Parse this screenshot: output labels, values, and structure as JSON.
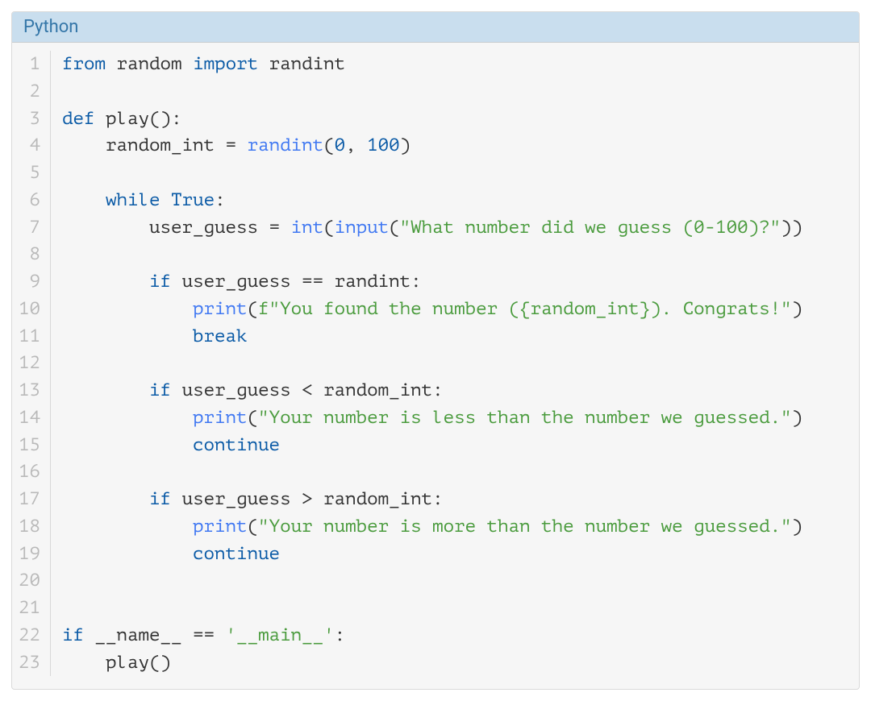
{
  "header": {
    "title": "Python"
  },
  "lineCount": 23,
  "code": {
    "lines": [
      [
        {
          "t": "from",
          "c": "kw"
        },
        {
          "t": " "
        },
        {
          "t": "random",
          "c": "id"
        },
        {
          "t": " "
        },
        {
          "t": "import",
          "c": "kw"
        },
        {
          "t": " "
        },
        {
          "t": "randint",
          "c": "id"
        }
      ],
      [],
      [
        {
          "t": "def",
          "c": "kw"
        },
        {
          "t": " "
        },
        {
          "t": "play",
          "c": "def"
        },
        {
          "t": "():",
          "c": "paren"
        }
      ],
      [
        {
          "t": "    "
        },
        {
          "t": "random_int",
          "c": "id"
        },
        {
          "t": " "
        },
        {
          "t": "=",
          "c": "op"
        },
        {
          "t": " "
        },
        {
          "t": "randint",
          "c": "call"
        },
        {
          "t": "(",
          "c": "paren"
        },
        {
          "t": "0",
          "c": "num"
        },
        {
          "t": ", ",
          "c": "paren"
        },
        {
          "t": "100",
          "c": "num"
        },
        {
          "t": ")",
          "c": "paren"
        }
      ],
      [],
      [
        {
          "t": "    "
        },
        {
          "t": "while",
          "c": "kw"
        },
        {
          "t": " "
        },
        {
          "t": "True",
          "c": "kw2"
        },
        {
          "t": ":",
          "c": "paren"
        }
      ],
      [
        {
          "t": "        "
        },
        {
          "t": "user_guess",
          "c": "id"
        },
        {
          "t": " "
        },
        {
          "t": "=",
          "c": "op"
        },
        {
          "t": " "
        },
        {
          "t": "int",
          "c": "call"
        },
        {
          "t": "(",
          "c": "paren"
        },
        {
          "t": "input",
          "c": "call"
        },
        {
          "t": "(",
          "c": "paren"
        },
        {
          "t": "\"What number did we guess (0-100)?\"",
          "c": "str"
        },
        {
          "t": "))",
          "c": "paren"
        }
      ],
      [],
      [
        {
          "t": "        "
        },
        {
          "t": "if",
          "c": "kw"
        },
        {
          "t": " "
        },
        {
          "t": "user_guess",
          "c": "id"
        },
        {
          "t": " "
        },
        {
          "t": "==",
          "c": "op"
        },
        {
          "t": " "
        },
        {
          "t": "randint",
          "c": "id"
        },
        {
          "t": ":",
          "c": "paren"
        }
      ],
      [
        {
          "t": "            "
        },
        {
          "t": "print",
          "c": "call"
        },
        {
          "t": "(",
          "c": "paren"
        },
        {
          "t": "f\"You found the number ({random_int}). Congrats!\"",
          "c": "str"
        },
        {
          "t": ")",
          "c": "paren"
        }
      ],
      [
        {
          "t": "            "
        },
        {
          "t": "break",
          "c": "kw"
        }
      ],
      [],
      [
        {
          "t": "        "
        },
        {
          "t": "if",
          "c": "kw"
        },
        {
          "t": " "
        },
        {
          "t": "user_guess",
          "c": "id"
        },
        {
          "t": " "
        },
        {
          "t": "<",
          "c": "op"
        },
        {
          "t": " "
        },
        {
          "t": "random_int",
          "c": "id"
        },
        {
          "t": ":",
          "c": "paren"
        }
      ],
      [
        {
          "t": "            "
        },
        {
          "t": "print",
          "c": "call"
        },
        {
          "t": "(",
          "c": "paren"
        },
        {
          "t": "\"Your number is less than the number we guessed.\"",
          "c": "str"
        },
        {
          "t": ")",
          "c": "paren"
        }
      ],
      [
        {
          "t": "            "
        },
        {
          "t": "continue",
          "c": "kw"
        }
      ],
      [],
      [
        {
          "t": "        "
        },
        {
          "t": "if",
          "c": "kw"
        },
        {
          "t": " "
        },
        {
          "t": "user_guess",
          "c": "id"
        },
        {
          "t": " "
        },
        {
          "t": ">",
          "c": "op"
        },
        {
          "t": " "
        },
        {
          "t": "random_int",
          "c": "id"
        },
        {
          "t": ":",
          "c": "paren"
        }
      ],
      [
        {
          "t": "            "
        },
        {
          "t": "print",
          "c": "call"
        },
        {
          "t": "(",
          "c": "paren"
        },
        {
          "t": "\"Your number is more than the number we guessed.\"",
          "c": "str"
        },
        {
          "t": ")",
          "c": "paren"
        }
      ],
      [
        {
          "t": "            "
        },
        {
          "t": "continue",
          "c": "kw"
        }
      ],
      [],
      [],
      [
        {
          "t": "if",
          "c": "kw"
        },
        {
          "t": " "
        },
        {
          "t": "__name__",
          "c": "id"
        },
        {
          "t": " "
        },
        {
          "t": "==",
          "c": "op"
        },
        {
          "t": " "
        },
        {
          "t": "'__main__'",
          "c": "str"
        },
        {
          "t": ":",
          "c": "paren"
        }
      ],
      [
        {
          "t": "    "
        },
        {
          "t": "play",
          "c": "id"
        },
        {
          "t": "()",
          "c": "paren"
        }
      ]
    ]
  }
}
